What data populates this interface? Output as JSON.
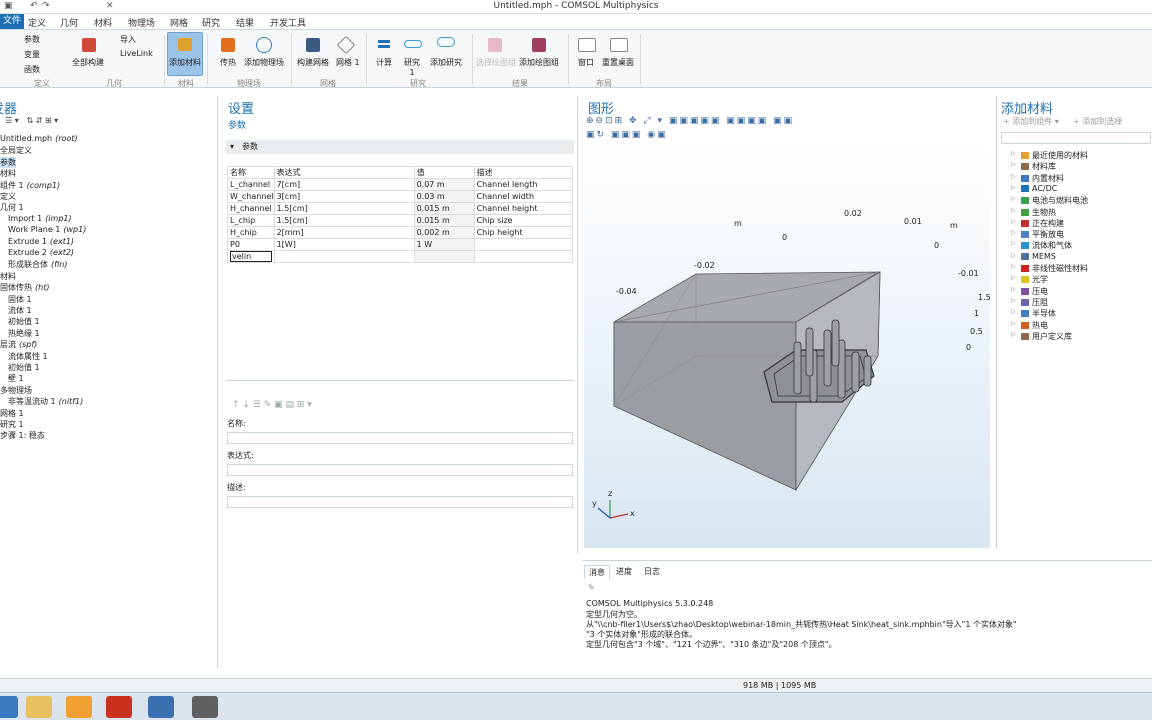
{
  "window": {
    "title": "Untitled.mph - COMSOL Multiphysics"
  },
  "tabs": [
    "文件",
    "定义",
    "几何",
    "材料",
    "物理场",
    "网格",
    "研究",
    "结果",
    "开发工具"
  ],
  "ribbon": {
    "parameters": "参数",
    "variables": "变量",
    "functions": "函数",
    "import": "导入",
    "livelink": "LiveLink",
    "build_all": "全部构建",
    "add_material": "添加材料",
    "heat_transfer": "传热",
    "add_physics": "添加物理场",
    "build_mesh": "构建网格",
    "mesh1": "网格 1",
    "compute": "计算",
    "study1": "研究 1",
    "add_study": "添加研究",
    "select_plot_group": "选择绘图组",
    "add_plot_group": "添加绘图组",
    "windows": "窗口",
    "reset_desktop": "重置桌面",
    "groups": [
      "定义",
      "几何",
      "材料",
      "物理场",
      "网格",
      "研究",
      "结果",
      "布局"
    ]
  },
  "model_builder": {
    "title": "模型开发器",
    "items": [
      {
        "text": "Untitled.mph",
        "tag": "(root)"
      },
      {
        "text": "全局定义",
        "tag": ""
      },
      {
        "text": "参数",
        "tag": ""
      },
      {
        "text": "材料",
        "tag": ""
      },
      {
        "text": "组件 1",
        "tag": "(comp1)"
      },
      {
        "text": "定义",
        "tag": ""
      },
      {
        "text": "几何 1",
        "tag": ""
      },
      {
        "text": "Import 1",
        "tag": "(imp1)"
      },
      {
        "text": "Work Plane 1",
        "tag": "(wp1)"
      },
      {
        "text": "Extrude 1",
        "tag": "(ext1)"
      },
      {
        "text": "Extrude 2",
        "tag": "(ext2)"
      },
      {
        "text": "形成联合体",
        "tag": "(fin)"
      },
      {
        "text": "材料",
        "tag": ""
      },
      {
        "text": "固体传热",
        "tag": "(ht)"
      },
      {
        "text": "固体 1",
        "tag": ""
      },
      {
        "text": "流体 1",
        "tag": ""
      },
      {
        "text": "初始值 1",
        "tag": ""
      },
      {
        "text": "热绝缘 1",
        "tag": ""
      },
      {
        "text": "层流",
        "tag": "(spf)"
      },
      {
        "text": "流体属性 1",
        "tag": ""
      },
      {
        "text": "初始值 1",
        "tag": ""
      },
      {
        "text": "壁 1",
        "tag": ""
      },
      {
        "text": "多物理场",
        "tag": ""
      },
      {
        "text": "非等温流动 1",
        "tag": "(nitf1)"
      },
      {
        "text": "网格 1",
        "tag": ""
      },
      {
        "text": "研究 1",
        "tag": ""
      },
      {
        "text": "步骤 1: 稳态",
        "tag": ""
      }
    ]
  },
  "settings": {
    "title": "设置",
    "subtitle": "参数",
    "section": "参数",
    "columns": [
      "名称",
      "表达式",
      "值",
      "描述"
    ],
    "rows": [
      [
        "L_channel",
        "7[cm]",
        "0.07 m",
        "Channel length"
      ],
      [
        "W_channel",
        "3[cm]",
        "0.03 m",
        "Channel width"
      ],
      [
        "H_channel",
        "1.5[cm]",
        "0.015 m",
        "Channel height"
      ],
      [
        "L_chip",
        "1.5[cm]",
        "0.015 m",
        "Chip size"
      ],
      [
        "H_chip",
        "2[mm]",
        "0.002 m",
        "Chip height"
      ],
      [
        "P0",
        "1[W]",
        "1 W",
        ""
      ]
    ],
    "editing": "velin",
    "name_label": "名称:",
    "expr_label": "表达式:",
    "desc_label": "描述:"
  },
  "graphics": {
    "title": "图形",
    "axis_labels": {
      "m_left": "m",
      "m_right": "m",
      "t_002": "0.02",
      "t_001": "0.01",
      "t_0a": "0",
      "t_0b": "0",
      "t_m002": "-0.02",
      "t_m004": "-0.04",
      "t_m001": "-0.01",
      "t_15": "1.5",
      "t_1": "1",
      "t_05": "0.5",
      "t_0c": "0"
    },
    "triad": {
      "x": "x",
      "y": "y",
      "z": "z"
    }
  },
  "add_material": {
    "title": "添加材料",
    "add_component": "添加到组件",
    "add_selection": "添加到选择",
    "items": [
      {
        "text": "最近使用的材料",
        "color": "#e0a030"
      },
      {
        "text": "材料库",
        "color": "#8a6a4a"
      },
      {
        "text": "内置材料",
        "color": "#3a78c0"
      },
      {
        "text": "AC/DC",
        "color": "#1f6fb5"
      },
      {
        "text": "电池与燃料电池",
        "color": "#3aa050"
      },
      {
        "text": "生物热",
        "color": "#40a040"
      },
      {
        "text": "正在构建",
        "color": "#c03030"
      },
      {
        "text": "平衡放电",
        "color": "#5080c0"
      },
      {
        "text": "流体和气体",
        "color": "#2a90d0"
      },
      {
        "text": "MEMS",
        "color": "#5070a0"
      },
      {
        "text": "非线性磁性材料",
        "color": "#d02020"
      },
      {
        "text": "光学",
        "color": "#e0c020"
      },
      {
        "text": "压电",
        "color": "#8050a0"
      },
      {
        "text": "压阻",
        "color": "#7060b0"
      },
      {
        "text": "半导体",
        "color": "#4080c0"
      },
      {
        "text": "热电",
        "color": "#d06020"
      },
      {
        "text": "用户定义库",
        "color": "#8a6a4a"
      }
    ]
  },
  "messages": {
    "tabs": [
      "消息",
      "进度",
      "日志"
    ],
    "lines": [
      "COMSOL Multiphysics 5.3.0.248",
      "定型几何为空。",
      "从\"\\\\cnb-filer1\\Users$\\zhao\\Desktop\\webinar-18min_共轭传热\\Heat Sink\\heat_sink.mphbin\"导入\"1 个实体对象\"",
      "\"3 个实体对象\"形成的联合体。",
      "定型几何包含\"3 个域\"、\"121 个边界\"、\"310 条边\"及\"208 个顶点\"。"
    ]
  },
  "status": {
    "memory": "918 MB | 1095 MB"
  }
}
